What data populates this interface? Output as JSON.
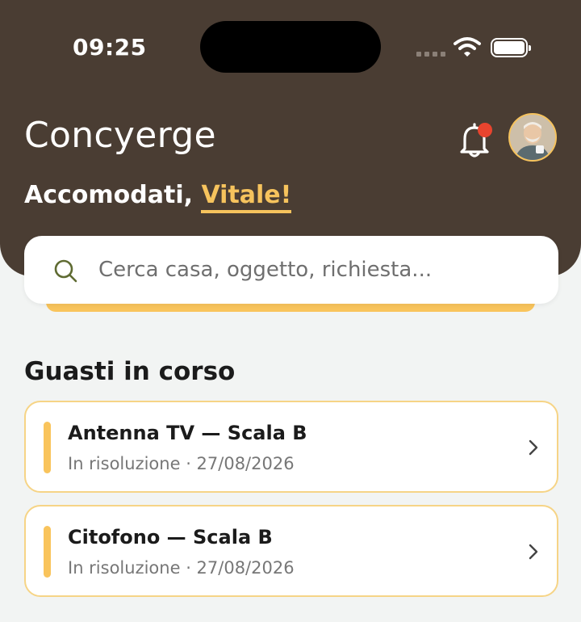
{
  "status_bar": {
    "time": "09:25"
  },
  "header": {
    "app_title": "Concyerge",
    "greeting_prefix": "Accomodati,",
    "greeting_name": "Vitale!"
  },
  "search": {
    "placeholder": "Cerca casa, oggetto, richiesta..."
  },
  "section": {
    "title": "Guasti in corso"
  },
  "faults": [
    {
      "title": "Antenna TV — Scala B",
      "meta": "In risoluzione · 27/08/2026"
    },
    {
      "title": "Citofono — Scala B",
      "meta": "In risoluzione · 27/08/2026"
    }
  ],
  "colors": {
    "header_bg": "#4a3d33",
    "accent": "#f6c35d",
    "notification_dot": "#e8442e",
    "page_bg": "#f2f4f3"
  },
  "icons": [
    "bell-icon",
    "search-icon",
    "chevron-right-icon",
    "wifi-icon",
    "battery-icon",
    "cellular-signal-icon"
  ]
}
